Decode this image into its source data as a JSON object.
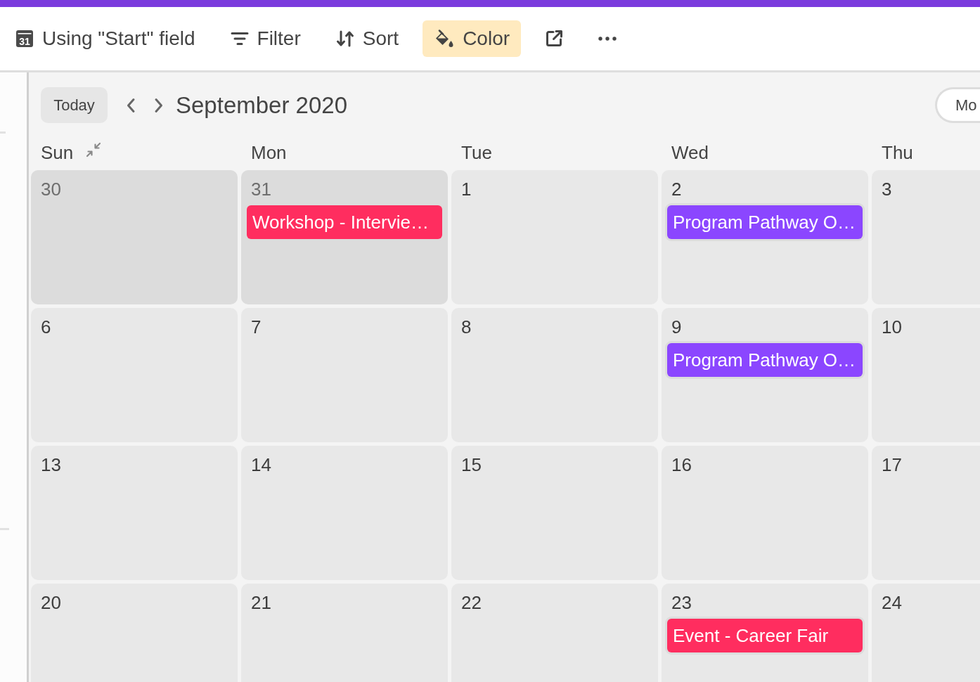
{
  "toolbar": {
    "items": [
      {
        "kind": "date-field",
        "icon_label": "31",
        "label": "Using \"Start\" field",
        "selected": false
      },
      {
        "kind": "filter",
        "label": "Filter",
        "selected": false
      },
      {
        "kind": "sort",
        "label": "Sort",
        "selected": false
      },
      {
        "kind": "color",
        "label": "Color",
        "selected": true
      },
      {
        "kind": "share",
        "selected": false
      },
      {
        "kind": "more",
        "selected": false
      }
    ]
  },
  "calendar": {
    "today_button": "Today",
    "title": "September 2020",
    "view_switch": "Mo",
    "weekdays": [
      {
        "label": "Sun",
        "kind": "collapsible"
      },
      {
        "label": "Mon",
        "kind": "plain"
      },
      {
        "label": "Tue",
        "kind": "plain"
      },
      {
        "label": "Wed",
        "kind": "plain"
      },
      {
        "label": "Thu",
        "kind": "plain"
      }
    ],
    "weeks": [
      {
        "days": [
          {
            "date": "30",
            "in_month": false
          },
          {
            "date": "31",
            "in_month": false,
            "events": [
              {
                "title": "Workshop - Intervie…",
                "color": "#ff2d5f"
              }
            ]
          },
          {
            "date": "1",
            "in_month": true
          },
          {
            "date": "2",
            "in_month": true,
            "events": [
              {
                "title": "Program Pathway O…",
                "color": "#8b46ff"
              }
            ]
          },
          {
            "date": "3",
            "in_month": true
          }
        ]
      },
      {
        "days": [
          {
            "date": "6",
            "in_month": true
          },
          {
            "date": "7",
            "in_month": true
          },
          {
            "date": "8",
            "in_month": true
          },
          {
            "date": "9",
            "in_month": true,
            "events": [
              {
                "title": "Program Pathway O…",
                "color": "#8b46ff"
              }
            ]
          },
          {
            "date": "10",
            "in_month": true
          }
        ]
      },
      {
        "days": [
          {
            "date": "13",
            "in_month": true
          },
          {
            "date": "14",
            "in_month": true
          },
          {
            "date": "15",
            "in_month": true
          },
          {
            "date": "16",
            "in_month": true
          },
          {
            "date": "17",
            "in_month": true
          }
        ]
      },
      {
        "days": [
          {
            "date": "20",
            "in_month": true
          },
          {
            "date": "21",
            "in_month": true
          },
          {
            "date": "22",
            "in_month": true
          },
          {
            "date": "23",
            "in_month": true,
            "events": [
              {
                "title": "Event - Career Fair",
                "color": "#ff2d5f"
              }
            ]
          },
          {
            "date": "24",
            "in_month": true
          }
        ]
      }
    ]
  }
}
